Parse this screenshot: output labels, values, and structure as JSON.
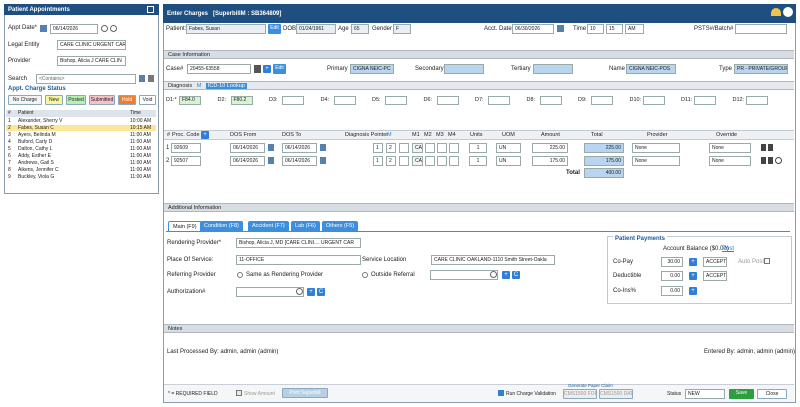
{
  "left_panel": {
    "title": "Patient Appointments",
    "appt_date_label": "Appt Date*",
    "appt_date": "06/14/2026",
    "legal_entity_label": "Legal Entity",
    "legal_entity": "CARE CLINIC URGENT CAR",
    "provider_label": "Provider",
    "provider": "Bishop, Alicia J CARE CLIN",
    "search_label": "Search",
    "search_placeholder": "<Contains>",
    "status_title": "Appt. Charge Status",
    "status_buttons": {
      "no_charge": "No Charge",
      "new": "New",
      "posted": "Posted",
      "submitted": "Submitted",
      "hold": "Hold",
      "void": "Void"
    },
    "table_headers": {
      "num": "#",
      "patient": "Patient",
      "time": "Time"
    },
    "rows": [
      {
        "num": "1",
        "patient": "Alexander, Sherry V",
        "time": "10:00 AM"
      },
      {
        "num": "2",
        "patient": "Fabes, Susan C",
        "time": "10:15 AM"
      },
      {
        "num": "3",
        "patient": "Ayers, Belinda M",
        "time": "11:00 AM"
      },
      {
        "num": "4",
        "patient": "Buford, Carly D",
        "time": "11:00 AM"
      },
      {
        "num": "5",
        "patient": "Dalton, Cathy L",
        "time": "11:00 AM"
      },
      {
        "num": "6",
        "patient": "Addy, Esther E",
        "time": "11:00 AM"
      },
      {
        "num": "7",
        "patient": "Andrews, Gail S",
        "time": "11:00 AM"
      },
      {
        "num": "8",
        "patient": "Aikens, Jennifer C",
        "time": "11:00 AM"
      },
      {
        "num": "9",
        "patient": "Buckley, Viola G",
        "time": "11:00 AM"
      }
    ]
  },
  "header": {
    "title": "Enter Charges",
    "superbill": "[SuperbillM : SB364809]"
  },
  "patient_row": {
    "patient_label": "Patient:",
    "patient": "Fabes, Susan",
    "edit": "Edit",
    "dob_label": "DOB",
    "dob": "01/24/1961",
    "age_label": "Age",
    "age": "65",
    "gender_label": "Gender",
    "gender": "F",
    "acct_date_label": "Acct. Date",
    "acct_date": "06/30/2026",
    "time_label": "Time",
    "hour": "10",
    "minute": "15",
    "ampm": "AM",
    "psts_label": "PSTS#/Batch#"
  },
  "case": {
    "section": "Case Information",
    "case_label": "Case#",
    "case_no": "20455-63558",
    "edit": "Edit",
    "primary_label": "Primary",
    "primary": "CIGNA  NEIC-PC",
    "secondary_label": "Secondary",
    "tertiary_label": "Tertiary",
    "name_label": "Name",
    "name": "CIGNA  NEIC-POS",
    "type_label": "Type",
    "type": "PR - PRIVATE/GROUP"
  },
  "diagnosis": {
    "label": "Diagnosis",
    "icd": "ICD-10 Lookup",
    "codes": [
      {
        "label": "D1:*",
        "value": "F84.0"
      },
      {
        "label": "D2:",
        "value": "F80.2"
      },
      {
        "label": "D3:",
        "value": ""
      },
      {
        "label": "D4:",
        "value": ""
      },
      {
        "label": "D5:",
        "value": ""
      },
      {
        "label": "D6:",
        "value": ""
      },
      {
        "label": "D7:",
        "value": ""
      },
      {
        "label": "D8:",
        "value": ""
      },
      {
        "label": "D9:",
        "value": ""
      },
      {
        "label": "D10:",
        "value": ""
      },
      {
        "label": "D11:",
        "value": ""
      },
      {
        "label": "D12:",
        "value": ""
      }
    ]
  },
  "proc_table": {
    "headers": {
      "proc": "Proc. Code",
      "dos_from": "DOS From",
      "dos_to": "DOS To",
      "dx_pointer": "Diagnosis Pointer",
      "m1": "M1",
      "m2": "M2",
      "m3": "M3",
      "m4": "M4",
      "units": "Units",
      "uom": "UOM",
      "amount": "Amount",
      "total": "Total",
      "provider": "Provider",
      "override": "Override"
    },
    "rows": [
      {
        "num": "1",
        "code": "92609",
        "from": "06/14/2026",
        "to": "06/14/2026",
        "p1": "1",
        "p2": "2",
        "m1": "CA",
        "units": "1",
        "uom": "UN",
        "amount": "225.00",
        "total": "225.00",
        "provider": "None",
        "override": "None"
      },
      {
        "num": "2",
        "code": "92507",
        "from": "06/14/2026",
        "to": "06/14/2026",
        "p1": "1",
        "p2": "2",
        "m1": "CA",
        "units": "1",
        "uom": "UN",
        "amount": "175.00",
        "total": "175.00",
        "provider": "None",
        "override": "None"
      }
    ],
    "total_label": "Total",
    "grand_total": "400.00"
  },
  "additional": {
    "section": "Additional Information",
    "tabs": [
      "Main (F9)",
      "Condition (F8)",
      "Accident (F7)",
      "Lab (F6)",
      "Others (F5)"
    ],
    "rendering_label": "Rendering Provider*",
    "rendering": "Bishop, Alicia J, MD [CARE CLINI.... URGENT CAR",
    "place_label": "Place Of Service:",
    "place": "11-OFFICE",
    "location_label": "Service Location",
    "location": "CARE CLINIC OAKLAND-1110 Smith Street-Oakla",
    "referring_label": "Referring Provider",
    "same_as": "Same as Rendering Provider",
    "outside": "Outside Referral",
    "auth_label": "Authorization#"
  },
  "payments": {
    "title": "Patient Payments",
    "balance_label": "Account Balance ($0.00)",
    "post": "Post",
    "copay_label": "Co-Pay",
    "copay": "30.00",
    "copay_status": "ACCEPT",
    "auto_post": "Auto Post",
    "deductible_label": "Deductible",
    "deductible": "0.00",
    "deductible_status": "ACCEPT",
    "coins_label": "Co-Ins%",
    "coins": "0.00"
  },
  "notes": {
    "section": "Notes"
  },
  "footer": {
    "last_processed": "Last Processed By: admin, admin (admin)",
    "entered_by": "Entered By: admin, admin (admin)",
    "required": "* = REQUIRED FIELD",
    "show_amount": "Show Amount",
    "print_superbill": "Print Superbill",
    "run_validation": "Run Charge Validation",
    "paper_claim_title": "Generate Paper Claim",
    "cms_form": "CMS1500 FORM",
    "cms_data": "CMS1500 DATA",
    "status_label": "Status",
    "status": "NEW",
    "save": "Save",
    "close": "Close"
  },
  "colors": {
    "header": "#1f4f80",
    "accent": "#3d8fdb",
    "highlight_row": "#fbe79a",
    "save": "#2e9e3e"
  }
}
